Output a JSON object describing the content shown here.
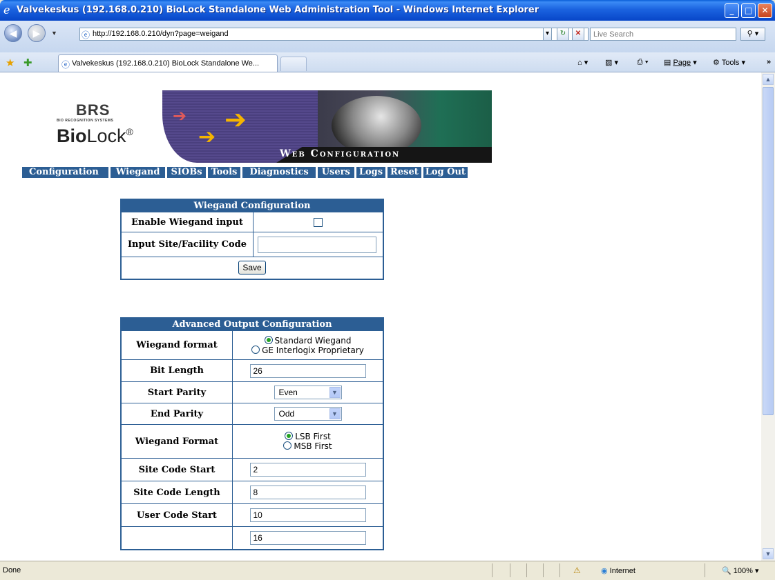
{
  "window": {
    "title": "Valvekeskus (192.168.0.210) BioLock Standalone Web Administration Tool - Windows Internet Explorer",
    "buttons": {
      "minimize": "_",
      "maximize": "□",
      "close": "✕"
    }
  },
  "address_bar": {
    "url": "http://192.168.0.210/dyn?page=weigand",
    "search_placeholder": "Live Search"
  },
  "tabs": [
    {
      "label": "Valvekeskus (192.168.0.210) BioLock Standalone We..."
    }
  ],
  "command_bar": {
    "page": "Page",
    "tools": "Tools"
  },
  "banner": {
    "brand": "BRS",
    "brand_sub": "BIO RECOGNITION SYSTEMS",
    "product_bold": "Bio",
    "product_rest": "Lock",
    "reg": "®",
    "tagline": "Web Configuration"
  },
  "nav": [
    {
      "label": "Configuration"
    },
    {
      "label": "Wiegand"
    },
    {
      "label": "SIOBs"
    },
    {
      "label": "Tools"
    },
    {
      "label": "Diagnostics"
    },
    {
      "label": "Users"
    },
    {
      "label": "Logs"
    },
    {
      "label": "Reset"
    },
    {
      "label": "Log Out"
    }
  ],
  "wiegand_config": {
    "header": "Wiegand Configuration",
    "enable_label": "Enable Wiegand input",
    "enable_checked": false,
    "site_code_label": "Input Site/Facility Code",
    "site_code_value": "",
    "save_label": "Save"
  },
  "advanced": {
    "header": "Advanced Output Configuration",
    "format_label": "Wiegand format",
    "format_options": [
      "Standard Wiegand",
      "GE Interlogix Proprietary"
    ],
    "format_selected": "Standard Wiegand",
    "bit_length_label": "Bit Length",
    "bit_length_value": "26",
    "start_parity_label": "Start Parity",
    "start_parity_value": "Even",
    "end_parity_label": "End Parity",
    "end_parity_value": "Odd",
    "order_label": "Wiegand Format",
    "order_options": [
      "LSB First",
      "MSB First"
    ],
    "order_selected": "LSB First",
    "site_start_label": "Site Code Start",
    "site_start_value": "2",
    "site_length_label": "Site Code Length",
    "site_length_value": "8",
    "user_start_label": "User Code Start",
    "user_start_value": "10",
    "user_length_value": "16"
  },
  "status": {
    "text": "Done",
    "zone": "Internet",
    "zoom": "100%"
  }
}
